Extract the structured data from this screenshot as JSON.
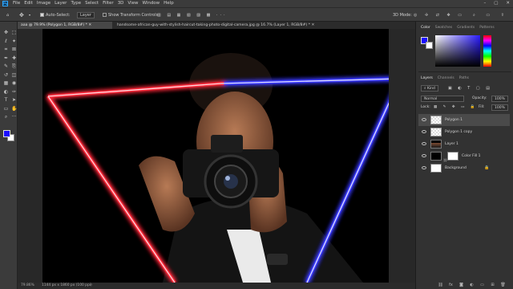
{
  "app": {
    "logo": "Ps"
  },
  "menu": [
    "File",
    "Edit",
    "Image",
    "Layer",
    "Type",
    "Select",
    "Filter",
    "3D",
    "View",
    "Window",
    "Help"
  ],
  "options": {
    "auto_select_label": "Auto-Select:",
    "auto_select_target": "Layer",
    "show_transform_label": "Show Transform Controls",
    "mode_3d_label": "3D Mode:"
  },
  "tabs": [
    {
      "label": "aaa @ 79.9% (Polygon 1, RGB/8#) *"
    },
    {
      "label": "handsome-african-guy-with-stylish-haircut-taking-photo-digital-camera.jpg @ 16.7% (Layer 1, RGB/8#) *"
    }
  ],
  "status": {
    "zoom": "79.86%",
    "doc_size": "1144 px x 1860 px (100 ppi)"
  },
  "colors": {
    "foreground": "#1a0cff",
    "background": "#ffffff",
    "neon_red": "#ff2a3a",
    "neon_blue": "#3a3aff",
    "ps_blue": "#31a8ff"
  },
  "color_panel": {
    "tabs": [
      "Color",
      "Swatches",
      "Gradients",
      "Patterns"
    ]
  },
  "layers_panel": {
    "tabs": [
      "Layers",
      "Channels",
      "Paths"
    ],
    "kind_label": "Kind",
    "blend_mode": "Normal",
    "opacity_label": "Opacity:",
    "opacity_value": "100%",
    "lock_label": "Lock:",
    "fill_label": "Fill:",
    "fill_value": "100%",
    "layers": [
      {
        "name": "Polygon 1",
        "thumb": "transparent",
        "selected": true
      },
      {
        "name": "Polygon 1 copy",
        "thumb": "transparent",
        "selected": false
      },
      {
        "name": "Layer 1",
        "thumb": "photo",
        "selected": false
      },
      {
        "name": "Color Fill 1",
        "thumb": "black",
        "selected": false
      },
      {
        "name": "Background",
        "thumb": "white",
        "selected": false
      }
    ]
  },
  "icons": {
    "tools": [
      "move-icon",
      "marquee-icon",
      "lasso-icon",
      "magic-wand-icon",
      "crop-icon",
      "frame-icon",
      "eyedropper-icon",
      "healing-icon",
      "brush-icon",
      "stamp-icon",
      "history-brush-icon",
      "eraser-icon",
      "gradient-icon",
      "blur-icon",
      "dodge-icon",
      "pen-icon",
      "type-icon",
      "path-select-icon",
      "shape-icon",
      "hand-icon",
      "zoom-icon",
      "more-icon"
    ]
  }
}
